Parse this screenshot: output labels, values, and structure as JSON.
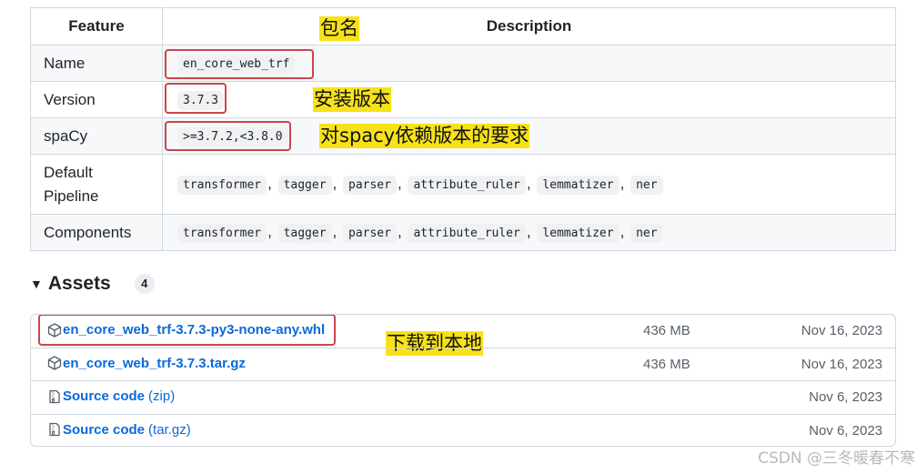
{
  "table": {
    "header": {
      "feature": "Feature",
      "description": "Description"
    },
    "rows": {
      "name": {
        "feature": "Name",
        "value": "en_core_web_trf"
      },
      "version": {
        "feature": "Version",
        "value": "3.7.3"
      },
      "spacy": {
        "feature": "spaCy",
        "value": ">=3.7.2,<3.8.0"
      },
      "pipeline": {
        "feature_line1": "Default",
        "feature_line2": "Pipeline",
        "items": [
          "transformer",
          "tagger",
          "parser",
          "attribute_ruler",
          "lemmatizer",
          "ner"
        ]
      },
      "components": {
        "feature": "Components",
        "items": [
          "transformer",
          "tagger",
          "parser",
          "attribute_ruler",
          "lemmatizer",
          "ner"
        ]
      }
    },
    "separator": ","
  },
  "annotations": {
    "package_name": "包名",
    "install_version": "安装版本",
    "spacy_requirement": "对spacy依赖版本的要求",
    "download_local": "下载到本地"
  },
  "assets": {
    "title": "Assets",
    "count": "4",
    "files": [
      {
        "name": "en_core_web_trf-3.7.3-py3-none-any.whl",
        "size": "436 MB",
        "date": "Nov 16, 2023",
        "icon": "package-icon"
      },
      {
        "name": "en_core_web_trf-3.7.3.tar.gz",
        "size": "436 MB",
        "date": "Nov 16, 2023",
        "icon": "package-icon"
      },
      {
        "name": "Source code",
        "sub": "(zip)",
        "date": "Nov 6, 2023",
        "icon": "file-zip-icon"
      },
      {
        "name": "Source code",
        "sub": "(tar.gz)",
        "date": "Nov 6, 2023",
        "icon": "file-zip-icon"
      }
    ]
  },
  "watermark": "CSDN @三冬暖春不寒",
  "colors": {
    "link": "#0969da",
    "highlight": "#f7e21a",
    "annotation_border": "#c9464d",
    "border": "#d0d7de"
  }
}
